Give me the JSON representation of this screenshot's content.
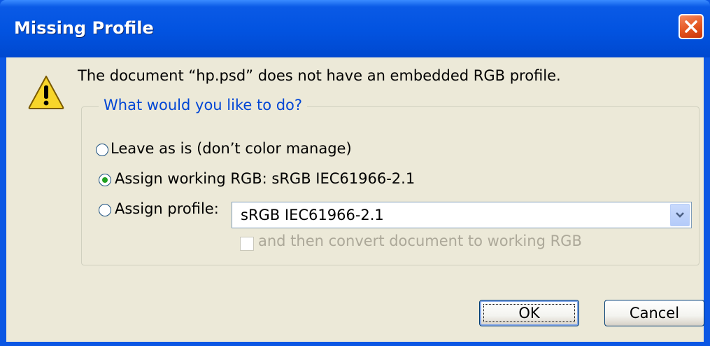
{
  "window": {
    "title": "Missing Profile",
    "close_icon": "close-icon"
  },
  "dialog": {
    "warning_icon": "warning-icon",
    "message": "The document “hp.psd” does not have an embedded RGB profile.",
    "group_legend": "What would you like to do?",
    "options": {
      "leave": {
        "label": "Leave as is (don’t color manage)",
        "selected": false
      },
      "assign_working": {
        "label": "Assign working RGB:  sRGB IEC61966-2.1",
        "selected": true
      },
      "assign_profile": {
        "label": "Assign profile:",
        "selected": false
      }
    },
    "profile_select": {
      "value": "sRGB IEC61966-2.1"
    },
    "convert_checkbox": {
      "label": "and then convert document to working RGB",
      "checked": false,
      "enabled": false
    }
  },
  "buttons": {
    "ok": "OK",
    "cancel": "Cancel"
  },
  "colors": {
    "title_bar": "#0253e0",
    "dialog_bg": "#ece9d8",
    "legend_text": "#0046d5",
    "radio_selected": "#21a121",
    "close_button": "#e4551f"
  }
}
